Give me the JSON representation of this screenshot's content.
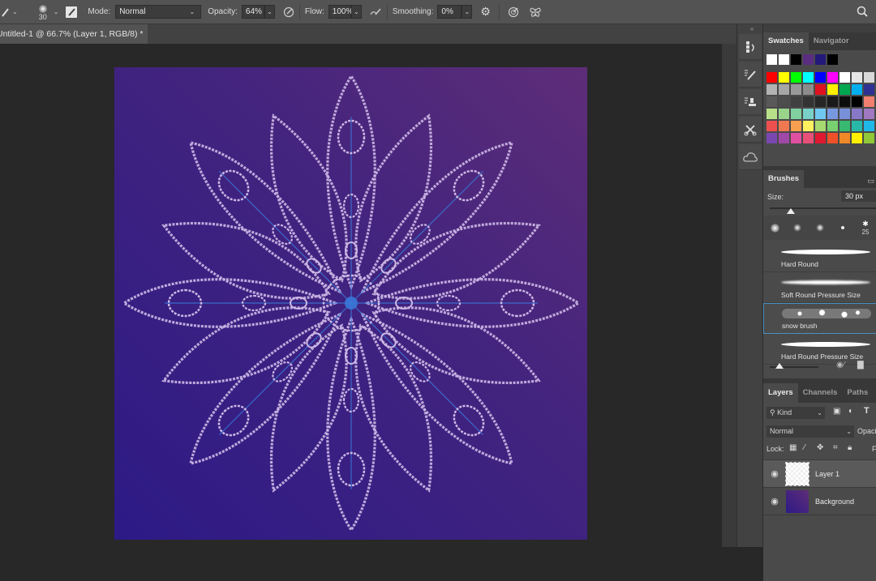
{
  "options_bar": {
    "brush_size": "30",
    "mode_label": "Mode:",
    "mode_value": "Normal",
    "opacity_label": "Opacity:",
    "opacity_value": "64%",
    "flow_label": "Flow:",
    "flow_value": "100%",
    "smoothing_label": "Smoothing:",
    "smoothing_value": "0%"
  },
  "document": {
    "tab_title": "Untitled-1 @ 66.7% (Layer 1, RGB/8) *"
  },
  "canvas": {
    "bg_colors": [
      "#2d1a86",
      "#43247e",
      "#5e2d78"
    ],
    "stroke_color": "#cdb8e6",
    "guide_color": "#3a78d8",
    "symmetry_segments": 8
  },
  "swatches_panel": {
    "tabs": [
      "Swatches",
      "Navigator"
    ],
    "recent": [
      "#ffffff",
      "#ffffff",
      "#000000",
      "#5a2d80",
      "#24197a",
      "#000000"
    ],
    "grid": [
      [
        "#ff0000",
        "#ffff00",
        "#00ff00",
        "#00ffff",
        "#0000ff",
        "#ff00ff",
        "#ffffff",
        "#e6e6e6",
        "#d9d9d9",
        "#cccccc"
      ],
      [
        "#b3b3b3",
        "#a6a6a6",
        "#999999",
        "#8c8c8c",
        "#e01020",
        "#fff000",
        "#00a650",
        "#00aeef",
        "#2e3192",
        "#ec008c"
      ],
      [
        "#595959",
        "#4d4d4d",
        "#404040",
        "#333333",
        "#262626",
        "#1a1a1a",
        "#0d0d0d",
        "#000000",
        "#f08070",
        "#f4a080"
      ],
      [
        "#b8e08a",
        "#98d48a",
        "#80d0a0",
        "#78d0c8",
        "#70c8f0",
        "#7898e0",
        "#7890d8",
        "#8878c8",
        "#a078c0",
        "#c078b8"
      ],
      [
        "#ee5050",
        "#f07850",
        "#f8a050",
        "#fff060",
        "#a8d870",
        "#78d070",
        "#38b870",
        "#28b8a8",
        "#20b8e8",
        "#3090d8"
      ],
      [
        "#7848b0",
        "#a048a8",
        "#e050a0",
        "#e85078",
        "#e01830",
        "#f05028",
        "#f08828",
        "#fff000",
        "#90c838",
        "#38b048"
      ]
    ]
  },
  "brushes_panel": {
    "tab": "Brushes",
    "size_label": "Size:",
    "size_value": "30 px",
    "size_fraction": 0.05,
    "preset_count_label": "25",
    "presets": [
      {
        "name": "Hard Round",
        "selected": false
      },
      {
        "name": "Soft Round Pressure Size",
        "selected": false
      },
      {
        "name": "snow brush",
        "selected": true
      },
      {
        "name": "Hard Round Pressure Size",
        "selected": false
      }
    ]
  },
  "layers_panel": {
    "tabs": [
      "Layers",
      "Channels",
      "Paths"
    ],
    "filter_label": "Kind",
    "blend_mode": "Normal",
    "opacity_label": "Opacity:",
    "lock_label": "Lock:",
    "fill_label": "F",
    "layers": [
      {
        "name": "Layer 1",
        "visible": true,
        "selected": true
      },
      {
        "name": "Background",
        "visible": true,
        "selected": false
      }
    ]
  }
}
